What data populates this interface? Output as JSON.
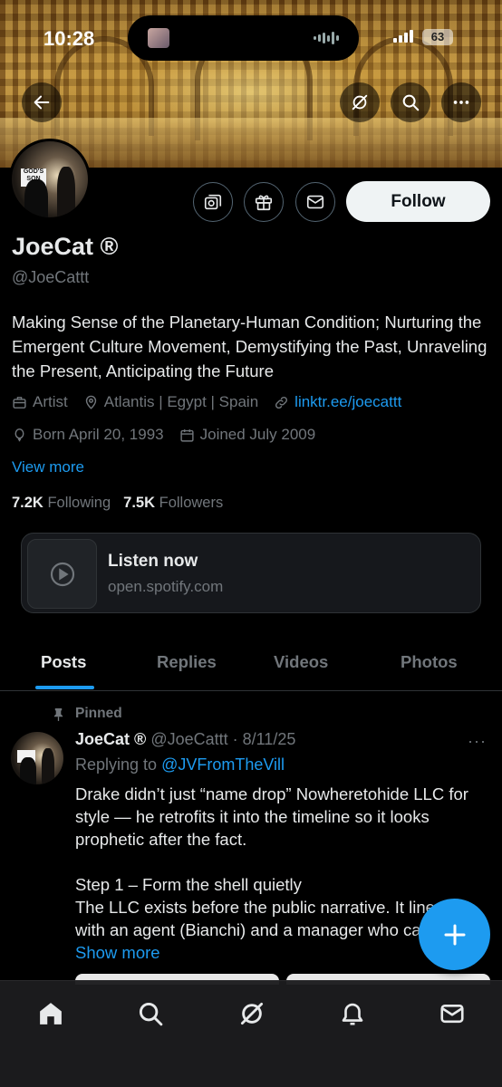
{
  "status_bar": {
    "time": "10:28",
    "battery": "63"
  },
  "header": {
    "back_icon": "arrow-left-icon",
    "grok_icon": "slash-circle-icon",
    "search_icon": "search-icon",
    "more_icon": "ellipsis-icon"
  },
  "profile": {
    "action_icons": [
      "subscribe-icon",
      "gift-icon",
      "mail-icon"
    ],
    "follow_label": "Follow",
    "name": "JoeCat ®",
    "handle": "@JoeCattt",
    "bio": "Making Sense of the Planetary-Human Condition; Nurturing the Emergent Culture Movement, Demystifying the Past, Unraveling the Present, Anticipating the Future",
    "profession": "Artist",
    "location": "Atlantis | Egypt | Spain",
    "link": "linktr.ee/joecattt",
    "born": "Born April 20, 1993",
    "joined": "Joined July 2009",
    "view_more": "View more",
    "following_count": "7.2K",
    "following_label": "Following",
    "followers_count": "7.5K",
    "followers_label": "Followers",
    "avatar_sign": "GOD'S SON"
  },
  "link_card": {
    "title": "Listen now",
    "url": "open.spotify.com"
  },
  "tabs": [
    {
      "label": "Posts",
      "active": true
    },
    {
      "label": "Replies",
      "active": false
    },
    {
      "label": "Videos",
      "active": false
    },
    {
      "label": "Photos",
      "active": false
    }
  ],
  "post": {
    "pinned_label": "Pinned",
    "author_name": "JoeCat ®",
    "author_handle": "@JoeCattt · 8/11/25",
    "more": "···",
    "replying_prefix": "Replying to ",
    "replying_to": "@JVFromTheVill",
    "paragraph1": "Drake didn’t just “name drop” Nowheretohide LLC for style — he retrofits it into the timeline so it looks prophetic after the fact.",
    "step_title": "Step 1 – Form the shell quietly",
    "step_body": "The LLC exists before the public narrative. It lines up with an agent (Bianchi) and a manager who can be ",
    "show_more": "Show more"
  },
  "bottom_nav": [
    "home-icon",
    "search-icon",
    "grok-icon",
    "notifications-icon",
    "messages-icon"
  ],
  "colors": {
    "accent": "#1d9bf0",
    "background": "#000000",
    "text": "#e7e9ea",
    "muted": "#71767b"
  }
}
